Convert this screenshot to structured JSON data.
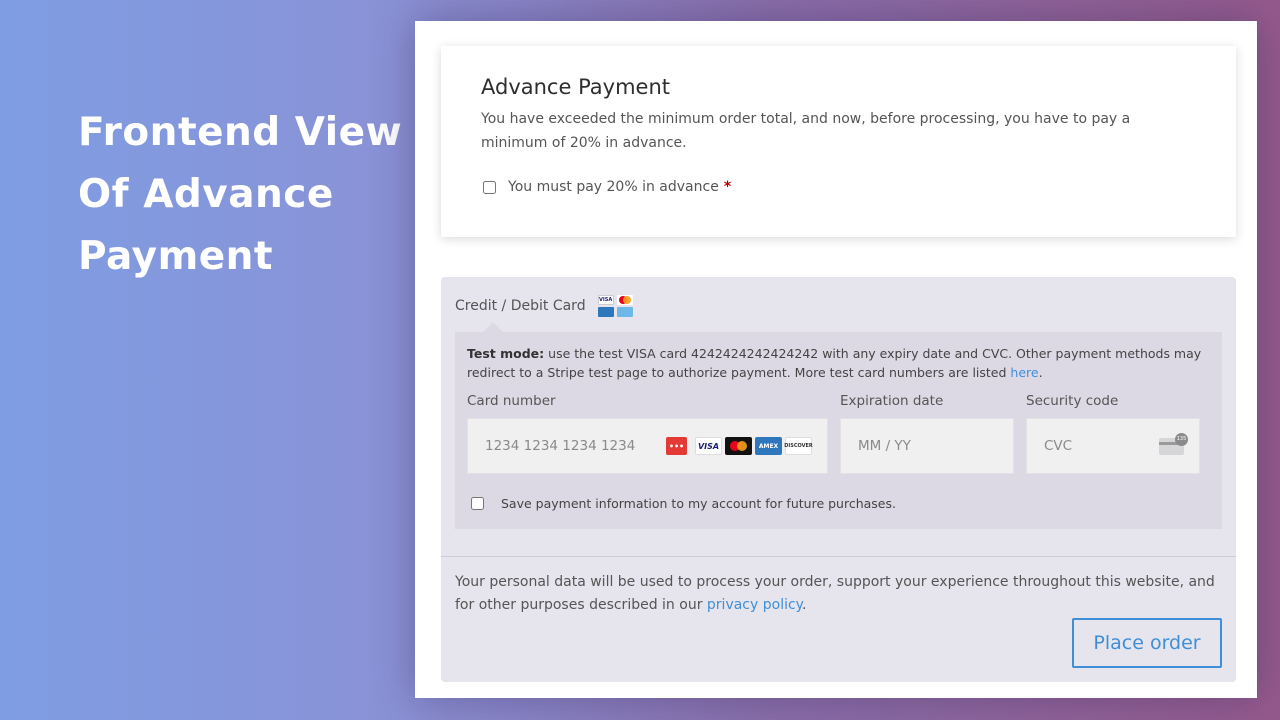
{
  "promo": {
    "heading_lines": [
      "Frontend View",
      "Of Advance",
      "Payment"
    ]
  },
  "advance_payment": {
    "title": "Advance Payment",
    "description": "You have exceeded the minimum order total, and now, before processing, you have to pay a minimum of 20% in advance.",
    "checkbox_label": "You must pay 20% in advance",
    "required_mark": "*",
    "checked": false
  },
  "payment_method": {
    "label": "Credit / Debit Card",
    "icons": [
      "visa-icon",
      "mastercard-icon",
      "amex-icon",
      "card-icon"
    ]
  },
  "stripe": {
    "test_mode_label": "Test mode:",
    "test_mode_text": "use the test VISA card 4242424242424242 with any expiry date and CVC. Other payment methods may redirect to a Stripe test page to authorize payment. More test card numbers are listed",
    "test_mode_link": "here",
    "test_mode_end": ".",
    "card_number_label": "Card number",
    "card_number_placeholder": "1234 1234 1234 1234",
    "expiry_label": "Expiration date",
    "expiry_placeholder": "MM / YY",
    "cvc_label": "Security code",
    "cvc_placeholder": "CVC",
    "cvc_badge": "135",
    "brand_icons": {
      "dots": "•••",
      "visa": "VISA",
      "amex": "AMEX",
      "discover": "DISCOVER"
    },
    "save_label": "Save payment information to my account for future purchases.",
    "save_checked": false
  },
  "privacy": {
    "text": "Your personal data will be used to process your order, support your experience throughout this website, and for other purposes described in our",
    "link": "privacy policy",
    "end": "."
  },
  "place_order_label": "Place order",
  "colors": {
    "accent": "#3f8fd8",
    "required": "#aa0000"
  }
}
